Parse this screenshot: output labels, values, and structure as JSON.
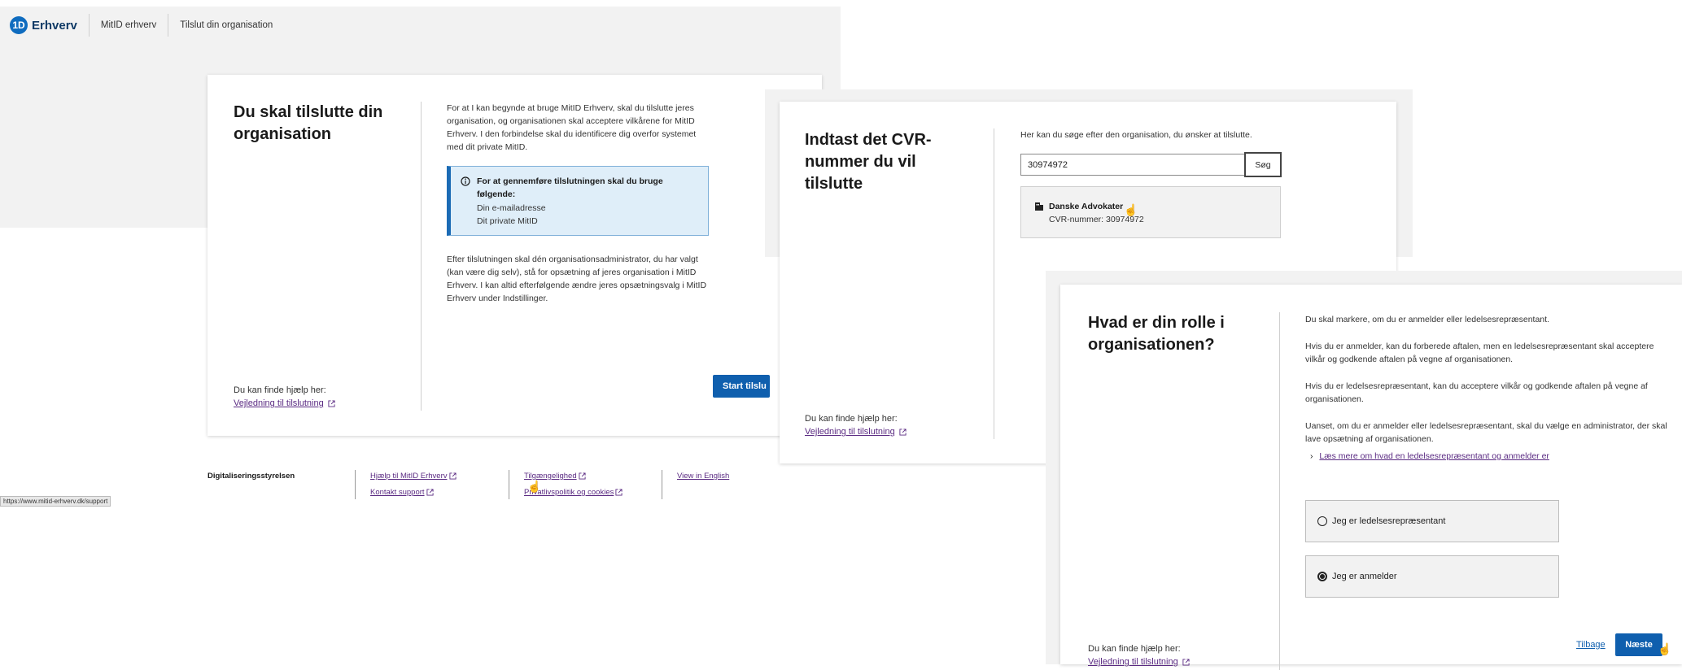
{
  "header": {
    "logo_mark": "1D",
    "logo_text": "Erhverv",
    "nav": [
      "MitID erhverv",
      "Tilslut din organisation"
    ]
  },
  "card1": {
    "title": "Du skal tilslutte din organisation",
    "intro": "For at I kan begynde at bruge MitID Erhverv, skal du tilslutte jeres organisation, og organisationen skal acceptere vilkårene for MitID Erhverv. I den forbindelse skal du identificere dig overfor systemet med dit private MitID.",
    "info_title": "For at gennemføre tilslutningen skal du bruge følgende:",
    "info_items": [
      "Din e-mailadresse",
      "Dit private MitID"
    ],
    "after": "Efter tilslutningen skal dén organisationsadministrator, du har valgt (kan være dig selv), stå for opsætning af jeres organisation i MitID Erhverv. I kan altid efterfølgende ændre jeres opsætningsvalg i MitID Erhverv under Indstillinger.",
    "help_label": "Du kan finde hjælp her:",
    "help_link": "Vejledning til tilslutning",
    "start_button": "Start tilslu"
  },
  "footer": {
    "org": "Digitaliseringsstyrelsen",
    "links": [
      "Hjælp til MitID Erhverv",
      "Kontakt support",
      "Tilgængelighed",
      "Privatlivspolitik og cookies",
      "View in English"
    ]
  },
  "status_url": "https://www.mitid-erhverv.dk/support",
  "card2": {
    "title": "Indtast det CVR-nummer du vil tilslutte",
    "instruction": "Her kan du søge efter den organisation, du ønsker at tilslutte.",
    "cvr_value": "30974972",
    "search_button": "Søg",
    "result_name": "Danske Advokater",
    "result_cvr": "CVR-nummer: 30974972",
    "help_label": "Du kan finde hjælp her:",
    "help_link": "Vejledning til tilslutning"
  },
  "card3": {
    "title": "Hvad er din rolle i organisationen?",
    "p1": "Du skal markere, om du er anmelder eller ledelsesrepræsentant.",
    "p2": "Hvis du er anmelder, kan du forberede aftalen, men en ledelsesrepræsentant skal acceptere vilkår og godkende aftalen på vegne af organisationen.",
    "p3": "Hvis du er ledelsesrepræsentant, kan du acceptere vilkår og godkende aftalen på vegne af organisationen.",
    "p4": "Uanset, om du er anmelder eller ledelsesrepræsentant, skal du vælge en administrator, der skal lave opsætning af organisationen.",
    "read_more": "Læs mere om hvad en ledelsesrepræsentant og anmelder er",
    "option1": "Jeg er ledelsesrepræsentant",
    "option2": "Jeg er anmelder",
    "selected": "option2",
    "back": "Tilbage",
    "next": "Næste",
    "help_label": "Du kan finde hjælp her:",
    "help_link": "Vejledning til tilslutning"
  },
  "colors": {
    "primary": "#0f5fae",
    "link": "#5a2a82",
    "info_bg": "#dfeef9",
    "info_border": "#1b6bb5"
  }
}
